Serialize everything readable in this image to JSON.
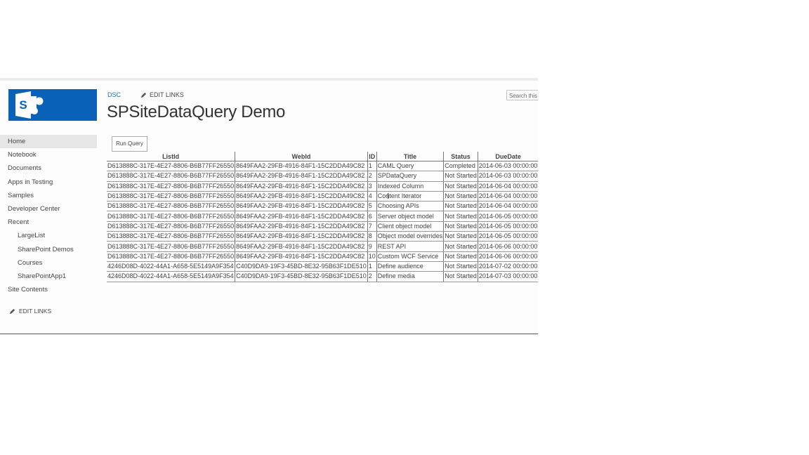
{
  "logo": {
    "icon": "sharepoint-logo-icon",
    "brand_color": "#0a62b8"
  },
  "top_nav": {
    "site_link": "DSC",
    "edit_links": "EDIT LINKS",
    "edit_icon": "pencil-icon"
  },
  "search": {
    "placeholder": "Search this"
  },
  "page_title": "SPSiteDataQuery Demo",
  "sidebar": {
    "items": [
      {
        "label": "Home",
        "selected": true
      },
      {
        "label": "Notebook"
      },
      {
        "label": "Documents"
      },
      {
        "label": "Apps in Testing"
      },
      {
        "label": "Samples"
      },
      {
        "label": "Developer Center"
      },
      {
        "label": "Recent"
      },
      {
        "label": "LargeList"
      },
      {
        "label": "SharePoint Demos"
      },
      {
        "label": "Courses"
      },
      {
        "label": "SharePointApp1"
      },
      {
        "label": "Site Contents"
      }
    ],
    "edit_links": "EDIT LINKS"
  },
  "run_button": "Run Query",
  "table": {
    "headers": [
      "ListId",
      "WebId",
      "ID",
      "Title",
      "Status",
      "DueDate"
    ],
    "rows": [
      [
        "D613888C-317E-4E27-8806-B6B77FF26550",
        "8649FAA2-29FB-4916-84F1-15C2DDA49C82",
        "1",
        "CAML Query",
        "Completed",
        "2014-06-03 00:00:00"
      ],
      [
        "D613888C-317E-4E27-8806-B6B77FF26550",
        "8649FAA2-29FB-4916-84F1-15C2DDA49C82",
        "2",
        "SPDataQuery",
        "Not Started",
        "2014-06-03 00:00:00"
      ],
      [
        "D613888C-317E-4E27-8806-B6B77FF26550",
        "8649FAA2-29FB-4916-84F1-15C2DDA49C82",
        "3",
        "Indexed Column",
        "Not Started",
        "2014-06-04 00:00:00"
      ],
      [
        "D613888C-317E-4E27-8806-B6B77FF26550",
        "8649FAA2-29FB-4916-84F1-15C2DDA49C82",
        "4",
        "Content Iterator",
        "Not Started",
        "2014-06-04 00:00:00"
      ],
      [
        "D613888C-317E-4E27-8806-B6B77FF26550",
        "8649FAA2-29FB-4916-84F1-15C2DDA49C82",
        "5",
        "Choosing APIs",
        "Not Started",
        "2014-06-04 00:00:00"
      ],
      [
        "D613888C-317E-4E27-8806-B6B77FF26550",
        "8649FAA2-29FB-4916-84F1-15C2DDA49C82",
        "6",
        "Server object model",
        "Not Started",
        "2014-06-05 00:00:00"
      ],
      [
        "D613888C-317E-4E27-8806-B6B77FF26550",
        "8649FAA2-29FB-4916-84F1-15C2DDA49C82",
        "7",
        "Client object model",
        "Not Started",
        "2014-06-05 00:00:00"
      ],
      [
        "D613888C-317E-4E27-8806-B6B77FF26550",
        "8649FAA2-29FB-4916-84F1-15C2DDA49C82",
        "8",
        "Object model overrides",
        "Not Started",
        "2014-06-05 00:00:00"
      ],
      [
        "D613888C-317E-4E27-8806-B6B77FF26550",
        "8649FAA2-29FB-4916-84F1-15C2DDA49C82",
        "9",
        "REST API",
        "Not Started",
        "2014-06-06 00:00:00"
      ],
      [
        "D613888C-317E-4E27-8806-B6B77FF26550",
        "8649FAA2-29FB-4916-84F1-15C2DDA49C82",
        "10",
        "Custom WCF Service",
        "Not Started",
        "2014-06-06 00:00:00"
      ],
      [
        "4246D08D-4022-44A1-A658-5E5149A9F354",
        "C40D9DA9-19F3-45BD-8E32-95B63F1DE510",
        "1",
        "Define audience",
        "Not Started",
        "2014-07-02 00:00:00"
      ],
      [
        "4246D08D-4022-44A1-A658-5E5149A9F354",
        "C40D9DA9-19F3-45BD-8E32-95B63F1DE510",
        "2",
        "Define media",
        "Not Started",
        "2014-07-03 00:00:00"
      ]
    ]
  }
}
